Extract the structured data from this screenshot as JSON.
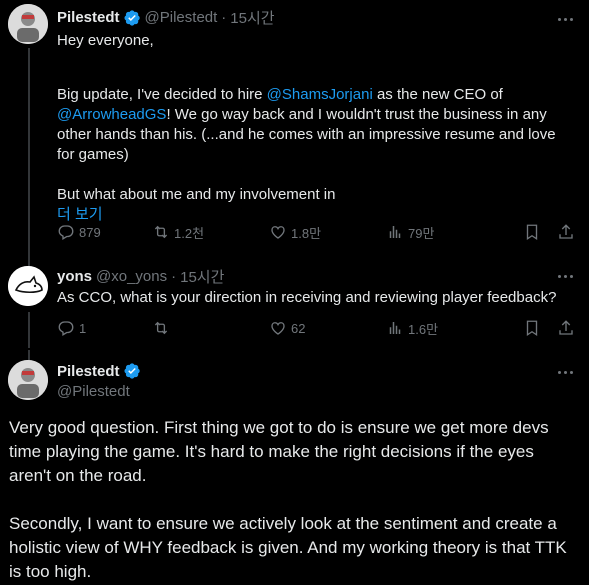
{
  "post1": {
    "name": "Pilestedt",
    "handle": "@Pilestedt",
    "time": "15시간",
    "lines": [
      "Hey everyone,",
      "",
      "Big update, I've decided to hire ",
      "@ShamsJorjani",
      " as the new CEO of",
      "@ArrowheadGS",
      "! We go way back and I wouldn't trust the business in any",
      "other hands than his. (...and he comes with an impressive resume and love",
      "for games)",
      "",
      "But what about me and my involvement in"
    ],
    "show_more": "더 보기",
    "replies": "879",
    "reposts": "1.2천",
    "likes": "1.8만",
    "views": "79만"
  },
  "post2": {
    "name": "yons",
    "handle": "@xo_yons",
    "time": "15시간",
    "text": "As CCO, what is your direction in receiving and reviewing player feedback?",
    "replies": "1",
    "reposts": "",
    "likes": "62",
    "views": "1.6만"
  },
  "post3": {
    "name": "Pilestedt",
    "handle": "@Pilestedt",
    "paragraph1": "Very good question. First thing we got to do is ensure we get more devs time playing the game. It's hard to make the right decisions if the eyes aren't on the road.",
    "paragraph2": "Secondly, I want to ensure we actively look at the sentiment and create a holistic view of WHY feedback is given. And my working theory is that TTK is too high."
  },
  "colors": {
    "background": "#000000",
    "text": "#e7e9ea",
    "muted": "#71767b",
    "link": "#1d9bf0",
    "verified": "#1d9bf0"
  }
}
